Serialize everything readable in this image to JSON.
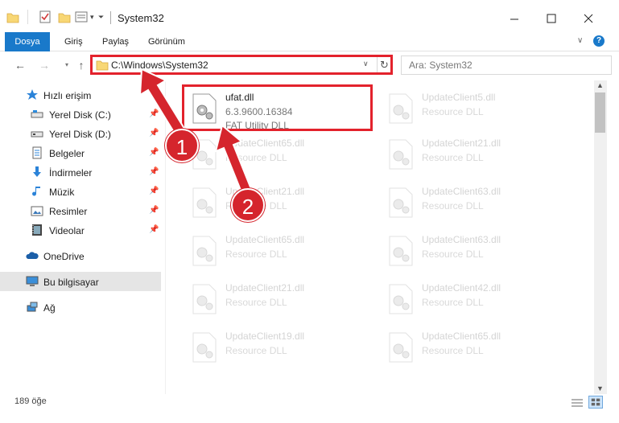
{
  "window": {
    "title": "System32"
  },
  "ribbon": {
    "tabs": [
      "Dosya",
      "Giriş",
      "Paylaş",
      "Görünüm"
    ],
    "help_label": "?"
  },
  "address": {
    "path": "C:\\Windows\\System32",
    "search_placeholder": "Ara: System32"
  },
  "sidebar": {
    "quick_access": "Hızlı erişim",
    "items": [
      {
        "label": "Yerel Disk (C:)",
        "icon": "drive-icon"
      },
      {
        "label": "Yerel Disk (D:)",
        "icon": "drive-icon"
      },
      {
        "label": "Belgeler",
        "icon": "documents-icon"
      },
      {
        "label": "İndirmeler",
        "icon": "download-icon"
      },
      {
        "label": "Müzik",
        "icon": "music-icon"
      },
      {
        "label": "Resimler",
        "icon": "pictures-icon"
      },
      {
        "label": "Videolar",
        "icon": "videos-icon"
      }
    ],
    "onedrive": "OneDrive",
    "this_pc": "Bu bilgisayar",
    "network": "Ağ"
  },
  "files": {
    "highlighted": {
      "name": "ufat.dll",
      "version": "6.3.9600.16384",
      "description": "FAT Utility DLL"
    },
    "items": [
      {
        "name": "UpdateClient5.dll",
        "description": "Resource DLL"
      },
      {
        "name": "UpdateClient65.dll",
        "description": "Resource DLL"
      },
      {
        "name": "UpdateClient21.dll",
        "description": "Resource DLL"
      },
      {
        "name": "UpdateClient21.dll",
        "description": "Resource DLL"
      },
      {
        "name": "UpdateClient63.dll",
        "description": "Resource DLL"
      },
      {
        "name": "UpdateClient65.dll",
        "description": "Resource DLL"
      },
      {
        "name": "UpdateClient63.dll",
        "description": "Resource DLL"
      },
      {
        "name": "UpdateClient21.dll",
        "description": "Resource DLL"
      },
      {
        "name": "UpdateClient42.dll",
        "description": "Resource DLL"
      },
      {
        "name": "UpdateClient19.dll",
        "description": "Resource DLL"
      },
      {
        "name": "UpdateClient65.dll",
        "description": "Resource DLL"
      }
    ]
  },
  "status": {
    "count": "189 öğe"
  },
  "annotations": {
    "step1": "1",
    "step2": "2",
    "color": "#d5252d"
  }
}
